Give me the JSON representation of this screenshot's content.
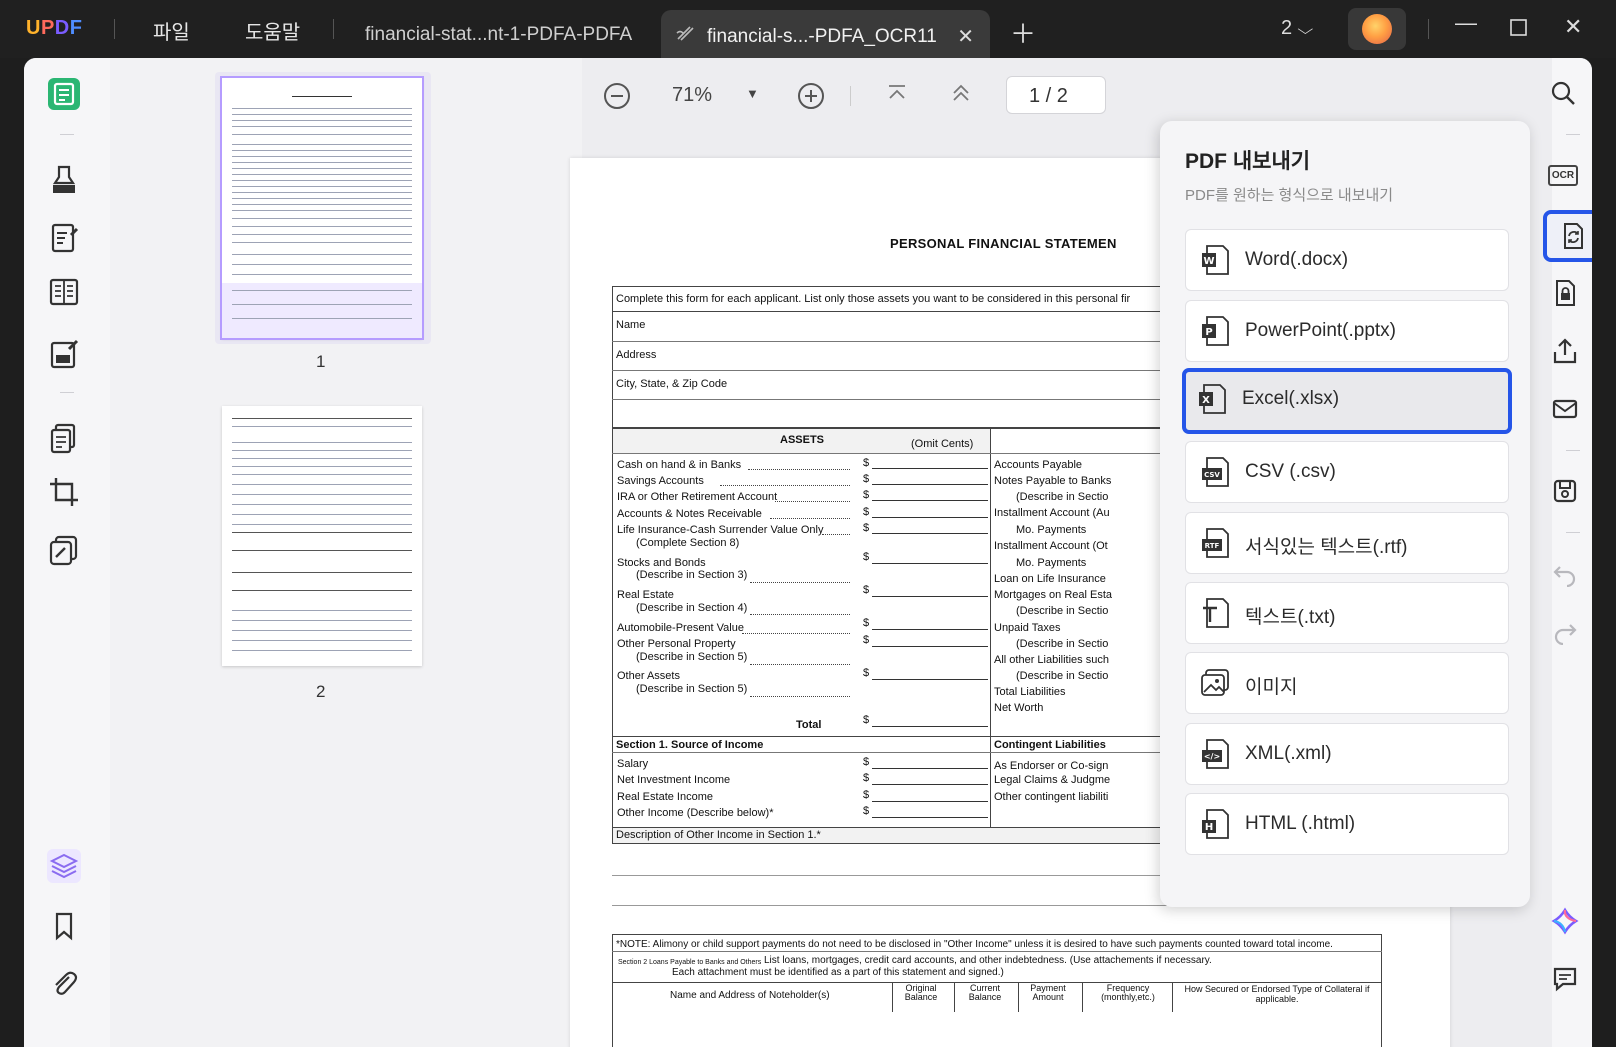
{
  "app": {
    "logo": "UPDF"
  },
  "menu": {
    "file": "파일",
    "help": "도움말"
  },
  "tabs": [
    {
      "label": "financial-stat...nt-1-PDFA-PDFA",
      "active": false
    },
    {
      "label": "financial-s...-PDFA_OCR11",
      "active": true
    }
  ],
  "window": {
    "page_count": "2"
  },
  "viewer": {
    "zoom": "71%",
    "page_indicator": "1 / 2"
  },
  "thumbnails": [
    {
      "number": "1"
    },
    {
      "number": "2"
    }
  ],
  "document": {
    "title": "PERSONAL FINANCIAL STATEMEN",
    "intro": "Complete this form for each applicant. List only those assets you want to be considered in this personal fir",
    "fields": [
      "Name",
      "Address",
      "City, State, & Zip Code"
    ],
    "assets_header": "ASSETS",
    "omit_cents": "(Omit Cents)",
    "assets": [
      {
        "label": "Cash on hand & in Banks",
        "sub": ""
      },
      {
        "label": "Savings Accounts",
        "sub": ""
      },
      {
        "label": "IRA or Other Retirement Account",
        "sub": ""
      },
      {
        "label": "Accounts & Notes Receivable",
        "sub": ""
      },
      {
        "label": "Life Insurance-Cash Surrender Value Only",
        "sub": "(Complete Section 8)"
      },
      {
        "label": "Stocks and Bonds",
        "sub": "(Describe in Section 3)"
      },
      {
        "label": "Real Estate",
        "sub": "(Describe in Section 4)"
      },
      {
        "label": "Automobile-Present Value",
        "sub": ""
      },
      {
        "label": "Other Personal Property",
        "sub": "(Describe in Section 5)"
      },
      {
        "label": "Other Assets",
        "sub": "(Describe in Section 5)"
      }
    ],
    "total": "Total",
    "dollar": "$",
    "liabilities": [
      "Accounts Payable",
      "Notes Payable to Banks",
      "(Describe in Sectio",
      "Installment Account (Au",
      "Mo. Payments",
      "Installment Account (Ot",
      "Mo. Payments",
      "Loan on Life Insurance",
      "Mortgages on Real Esta",
      "(Describe in Sectio",
      "Unpaid Taxes",
      "(Describe in Sectio",
      "All other Liabilities such",
      "(Describe in Sectio",
      "Total Liabilities",
      "Net Worth"
    ],
    "section1_title": "Section 1. Source of Income",
    "income": [
      "Salary",
      "Net Investment Income",
      "Real Estate Income",
      "Other Income (Describe below)*"
    ],
    "contingent_title": "Contingent Liabilities",
    "contingent": [
      "As Endorser or Co-sign",
      "Legal Claims & Judgme",
      "Other contingent liabiliti"
    ],
    "other_income_desc": "Description of Other Income in Section 1.*",
    "note": "*NOTE: Alimony or child support payments do not need to be disclosed in \"Other Income\" unless it is desired to have such payments counted toward total income.",
    "section2_small": "Section 2 Loans Payable to Banks and Others",
    "section2_text": "List loans, mortgages, credit card accounts, and other indebtedness. (Use attachements if necessary.",
    "section2_text2": "Each attachment must be identified as a part of this statement and signed.)",
    "table_headers": [
      "Name and Address of Noteholder(s)",
      "Original Balance",
      "Current Balance",
      "Payment Amount",
      "Frequency (monthly,etc.)",
      "How Secured or Endorsed Type of Collateral if applicable."
    ]
  },
  "export_panel": {
    "title": "PDF 내보내기",
    "subtitle": "PDF를 원하는 형식으로 내보내기",
    "options": [
      {
        "label": "Word(.docx)",
        "icon": "word-icon",
        "selected": false
      },
      {
        "label": "PowerPoint(.pptx)",
        "icon": "powerpoint-icon",
        "selected": false
      },
      {
        "label": "Excel(.xlsx)",
        "icon": "excel-icon",
        "selected": true
      },
      {
        "label": "CSV (.csv)",
        "icon": "csv-icon",
        "selected": false
      },
      {
        "label": "서식있는 텍스트(.rtf)",
        "icon": "rtf-icon",
        "selected": false
      },
      {
        "label": "텍스트(.txt)",
        "icon": "txt-icon",
        "selected": false
      },
      {
        "label": "이미지",
        "icon": "image-icon",
        "selected": false
      },
      {
        "label": "XML(.xml)",
        "icon": "xml-icon",
        "selected": false
      },
      {
        "label": "HTML (.html)",
        "icon": "html-icon",
        "selected": false
      }
    ]
  },
  "colors": {
    "accent": "#2555e8",
    "reader_green": "#2bb673",
    "titlebar": "#202020"
  }
}
